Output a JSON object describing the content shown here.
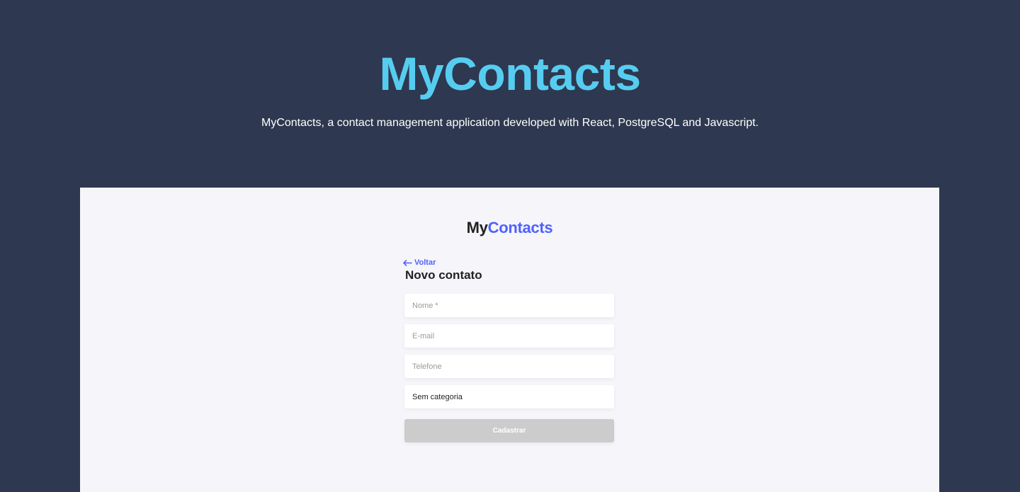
{
  "hero": {
    "title": "MyContacts",
    "subtitle": "MyContacts, a contact management application developed with React, PostgreSQL and Javascript."
  },
  "app": {
    "logo_my": "My",
    "logo_contacts": "Contacts",
    "back_label": "Voltar",
    "form_title": "Novo contato",
    "fields": {
      "name_placeholder": "Nome *",
      "name_value": "",
      "email_placeholder": "E-mail",
      "email_value": "",
      "phone_placeholder": "Telefone",
      "phone_value": "",
      "category_selected": "Sem categoria"
    },
    "submit_label": "Cadastrar",
    "submit_disabled": true
  },
  "colors": {
    "page_background": "#2e3850",
    "hero_title": "#56cdf0",
    "app_background": "#f5f5fa",
    "accent": "#5061fc",
    "button_disabled": "#cccccc"
  },
  "icons": {
    "back": "arrow-left-icon"
  }
}
